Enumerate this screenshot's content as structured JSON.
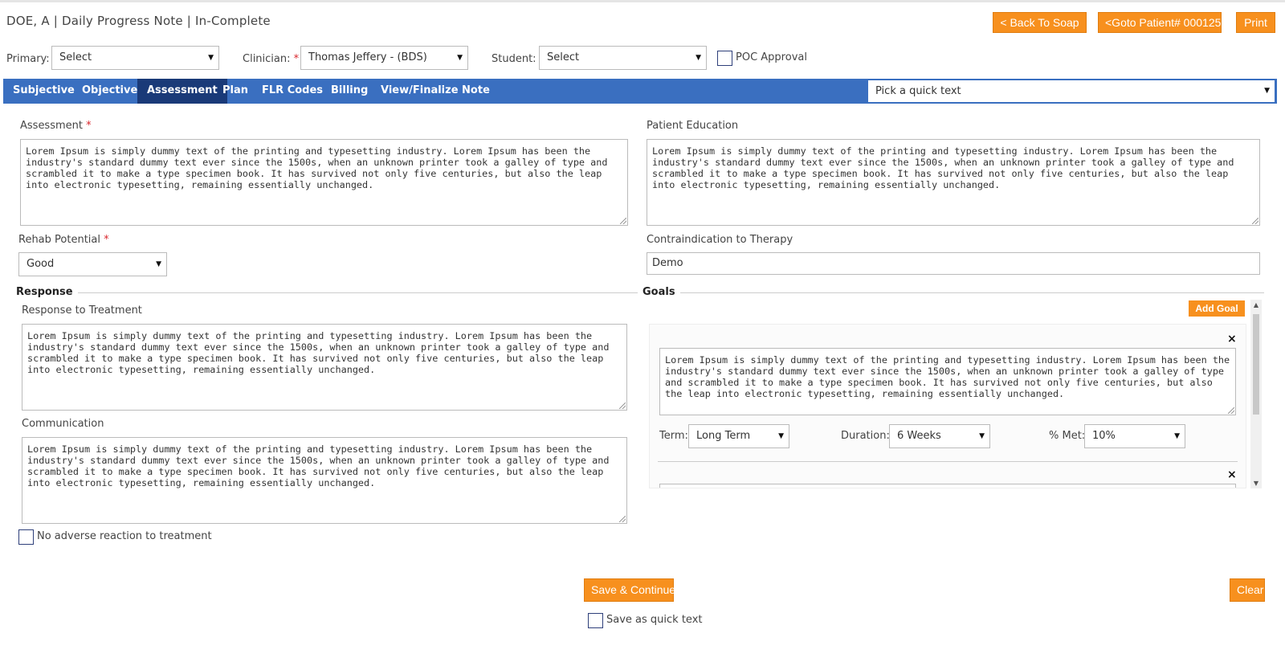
{
  "header": {
    "title": "DOE, A | Daily Progress Note | In-Complete",
    "back_to_soap": "<  Back To Soap",
    "goto_patient": "<Goto Patient# 000125",
    "print": "Print"
  },
  "filters": {
    "primary_label": "Primary:",
    "primary_value": "Select",
    "clinician_label": "Clinician:",
    "clinician_value": "Thomas Jeffery - (BDS)",
    "student_label": "Student:",
    "student_value": "Select",
    "poc_label": "POC Approval"
  },
  "tabs": [
    {
      "label": "Subjective"
    },
    {
      "label": "Objective"
    },
    {
      "label": "Assessment"
    },
    {
      "label": "Plan"
    },
    {
      "label": "FLR Codes"
    },
    {
      "label": "Billing"
    },
    {
      "label": "View/Finalize Note"
    }
  ],
  "quick_text": {
    "placeholder": "Pick a quick text"
  },
  "lorem": "Lorem Ipsum is simply dummy text of the printing and typesetting industry. Lorem Ipsum has been the industry's standard dummy text ever since the 1500s, when an unknown printer took a galley of type and scrambled it to make a type specimen book. It has survived not only five centuries, but also the leap into electronic typesetting, remaining essentially unchanged.",
  "form": {
    "assessment_label": "Assessment",
    "assessment_text": "Lorem Ipsum is simply dummy text of the printing and typesetting industry. Lorem Ipsum has been the industry's standard dummy text ever since the 1500s, when an unknown printer took a galley of type and scrambled it to make a type specimen book. It has survived not only five centuries, but also the leap into electronic typesetting, remaining essentially unchanged.",
    "patient_education_label": "Patient Education",
    "patient_education_text": "Lorem Ipsum is simply dummy text of the printing and typesetting industry. Lorem Ipsum has been the industry's standard dummy text ever since the 1500s, when an unknown printer took a galley of type and scrambled it to make a type specimen book. It has survived not only five centuries, but also the leap into electronic typesetting, remaining essentially unchanged.",
    "rehab_label": "Rehab Potential",
    "rehab_value": "Good",
    "contra_label": "Contraindication to Therapy",
    "contra_value": "Demo",
    "required_mark": "*"
  },
  "response": {
    "section_title": "Response",
    "rtt_label": "Response to Treatment",
    "rtt_text": "Lorem Ipsum is simply dummy text of the printing and typesetting industry. Lorem Ipsum has been the industry's standard dummy text ever since the 1500s, when an unknown printer took a galley of type and scrambled it to make a type specimen book. It has survived not only five centuries, but also the leap into electronic typesetting, remaining essentially unchanged.",
    "comm_label": "Communication",
    "comm_text": "Lorem Ipsum is simply dummy text of the printing and typesetting industry. Lorem Ipsum has been the industry's standard dummy text ever since the 1500s, when an unknown printer took a galley of type and scrambled it to make a type specimen book. It has survived not only five centuries, but also the leap into electronic typesetting, remaining essentially unchanged.",
    "no_adverse_label": "No adverse reaction to treatment"
  },
  "goals": {
    "section_title": "Goals",
    "add_goal": "Add Goal",
    "close_glyph": "×",
    "items": [
      {
        "text": "Lorem Ipsum is simply dummy text of the printing and typesetting industry. Lorem Ipsum has been the industry's standard dummy text ever since the 1500s, when an unknown printer took a galley of type and scrambled it to make a type specimen book. It has survived not only five centuries, but also the leap into electronic typesetting, remaining essentially unchanged.",
        "term_label": "Term:",
        "term_value": "Long Term",
        "duration_label": "Duration:",
        "duration_value": "6 Weeks",
        "met_label": "% Met:",
        "met_value": "10%"
      }
    ]
  },
  "footer": {
    "save_continue": "Save & Continue",
    "clear": "Clear",
    "save_quick_label": "Save as quick text"
  },
  "colors": {
    "accent_orange": "#f7901e",
    "nav_blue": "#3a6fc0",
    "active_tab": "#1a3a78",
    "required_red": "#d9262c"
  }
}
